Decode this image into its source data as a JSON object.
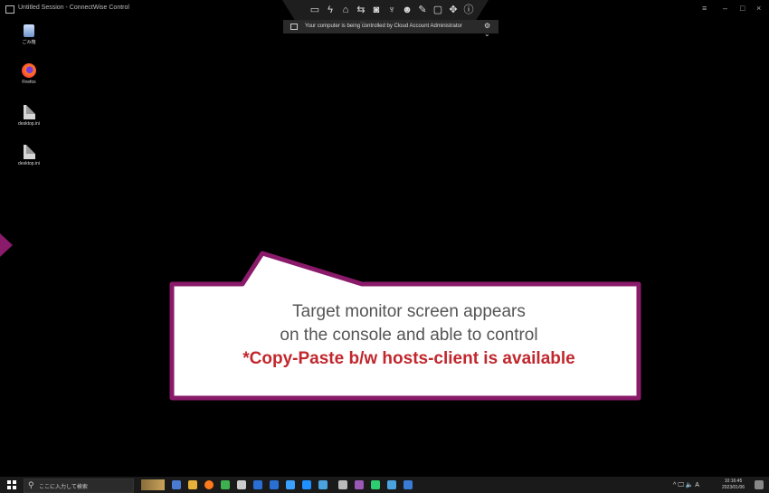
{
  "window": {
    "title": "Untitled Session - ConnectWise Control",
    "controls": [
      "≡",
      "–",
      "□",
      "×"
    ]
  },
  "toolbar": {
    "icons": [
      "monitor-icon",
      "lightning-icon",
      "briefcase-icon",
      "swap-icon",
      "camera-icon",
      "microphone-icon",
      "users-icon",
      "pen-icon",
      "chat-icon",
      "move-icon",
      "info-icon"
    ]
  },
  "banner": {
    "text": "Your computer is being controlled by Cloud Account Administrator",
    "gear": "⚙ ⌄"
  },
  "desktop": {
    "icons": [
      {
        "label": "ごみ箱",
        "kind": "recycle"
      },
      {
        "label": "Firefox",
        "kind": "firefox"
      },
      {
        "label": "desktop.ini",
        "kind": "file"
      },
      {
        "label": "desktop.ini",
        "kind": "file"
      }
    ]
  },
  "callout": {
    "line1": "Target monitor screen appears",
    "line2": "on the console and able to control",
    "line3": "*Copy-Paste b/w hosts-client is available",
    "colors": {
      "border": "#8a1a6a",
      "fill": "#ffffff",
      "text": "#555555",
      "emphasis": "#c1272d"
    }
  },
  "taskbar": {
    "search_placeholder": "ここに入力して検索",
    "apps": [
      "#4a7bd1",
      "#e8b13a",
      "#ff7a1a",
      "#3fb04f",
      "#cccccc",
      "#2a6fd6",
      "#2a6fd6",
      "#3aa0ff",
      "#2a6fd6",
      "#1e90ff",
      "#bbbbbb",
      "#9b59b6",
      "#2ecc71",
      "#4aa3df",
      "#3a7bd5"
    ],
    "tray_text": "^ 🖵 🔈 A",
    "clock_time": "10:16:45",
    "clock_date": "2023/01/06"
  }
}
